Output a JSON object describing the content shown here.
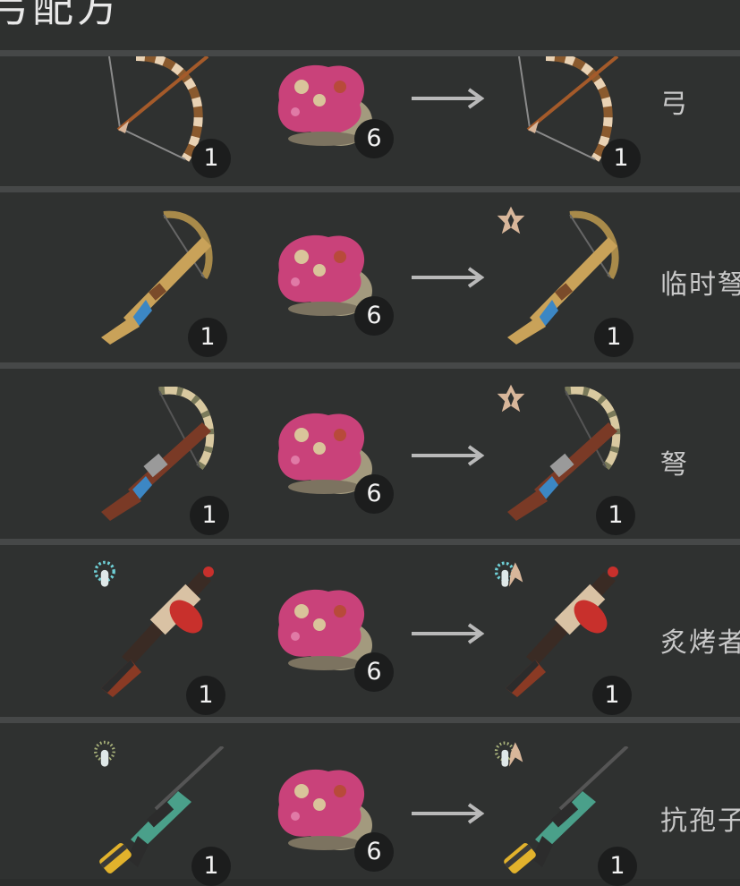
{
  "header": {
    "title": "弓配方"
  },
  "recipes": [
    {
      "input_item": "bow",
      "input_count": "1",
      "material_item": "pink-ore-chunk",
      "material_count": "6",
      "output_item": "bow",
      "output_count": "1",
      "name": "弓",
      "input_tier_icon": "",
      "output_tier_icon": ""
    },
    {
      "input_item": "makeshift-crossbow",
      "input_count": "1",
      "material_item": "pink-ore-chunk",
      "material_count": "6",
      "output_item": "makeshift-crossbow",
      "output_count": "1",
      "name": "临时弩",
      "input_tier_icon": "",
      "output_tier_icon": "tier-icon-beige"
    },
    {
      "input_item": "crossbow",
      "input_count": "1",
      "material_item": "pink-ore-chunk",
      "material_count": "6",
      "output_item": "crossbow",
      "output_count": "1",
      "name": "弩",
      "input_tier_icon": "",
      "output_tier_icon": "tier-icon-beige"
    },
    {
      "input_item": "flamethrower",
      "input_count": "1",
      "material_item": "pink-ore-chunk",
      "material_count": "6",
      "output_item": "flamethrower",
      "output_count": "1",
      "name": "炙烤者",
      "input_tier_icon": "tier-icon-cyan",
      "output_tier_icon": "tier-icon-cyan-beige"
    },
    {
      "input_item": "anti-spore-rifle",
      "input_count": "1",
      "material_item": "pink-ore-chunk",
      "material_count": "6",
      "output_item": "anti-spore-rifle",
      "output_count": "1",
      "name": "抗孢子",
      "input_tier_icon": "tier-icon-olive",
      "output_tier_icon": "tier-icon-olive-beige"
    }
  ],
  "colors": {
    "background": "#2b2d2c",
    "row": "#2f3130",
    "separator": "#464848",
    "badge": "#1c1d1d",
    "ore_pink": "#c9427a",
    "tier_beige": "#d8b69a",
    "tier_cyan": "#6fd0d6",
    "tier_olive": "#a8b27a"
  }
}
